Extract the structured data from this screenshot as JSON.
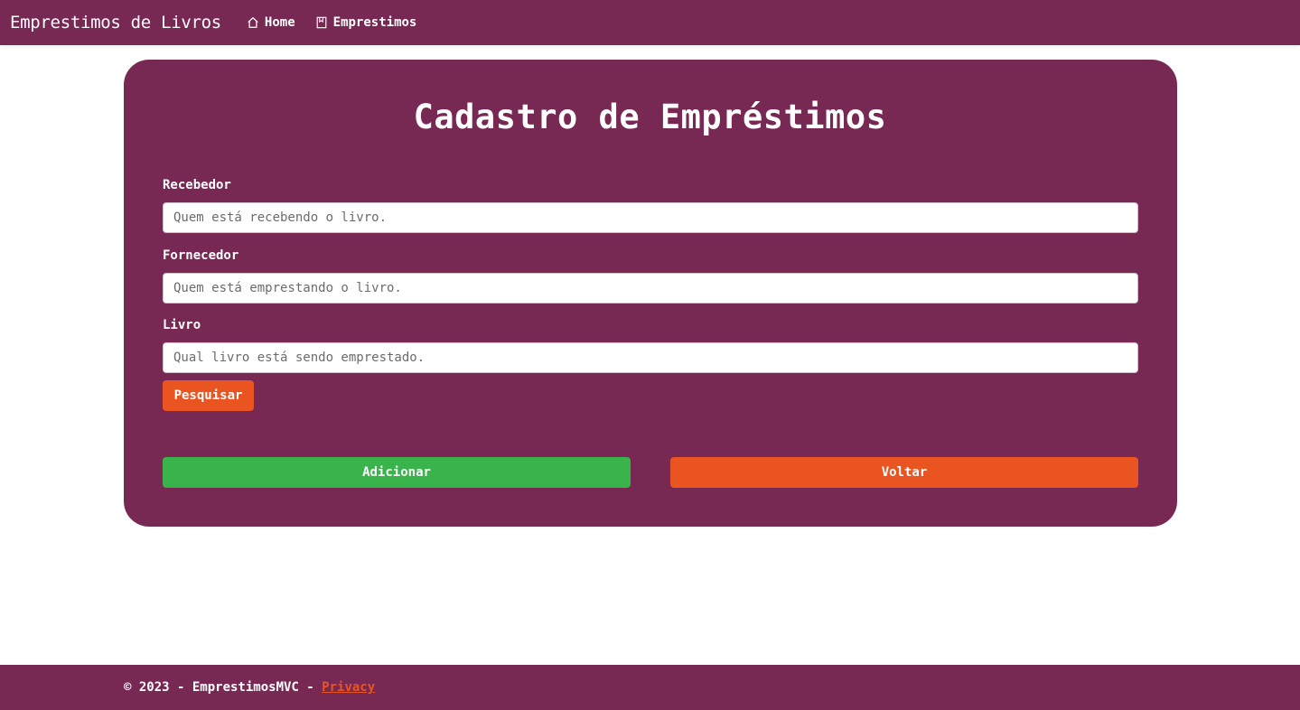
{
  "navbar": {
    "brand": "Emprestimos de Livros",
    "links": [
      {
        "label": "Home",
        "icon": "home-icon"
      },
      {
        "label": "Emprestimos",
        "icon": "book-icon"
      }
    ]
  },
  "form": {
    "title": "Cadastro de Empréstimos",
    "fields": [
      {
        "label": "Recebedor",
        "placeholder": "Quem está recebendo o livro.",
        "value": ""
      },
      {
        "label": "Fornecedor",
        "placeholder": "Quem está emprestando o livro.",
        "value": ""
      },
      {
        "label": "Livro",
        "placeholder": "Qual livro está sendo emprestado.",
        "value": ""
      }
    ],
    "search_label": "Pesquisar",
    "add_label": "Adicionar",
    "back_label": "Voltar"
  },
  "footer": {
    "text": "© 2023 - EmprestimosMVC - ",
    "privacy_label": "Privacy"
  },
  "colors": {
    "primary": "#772953",
    "accent": "#e95420",
    "success": "#38b44a"
  }
}
